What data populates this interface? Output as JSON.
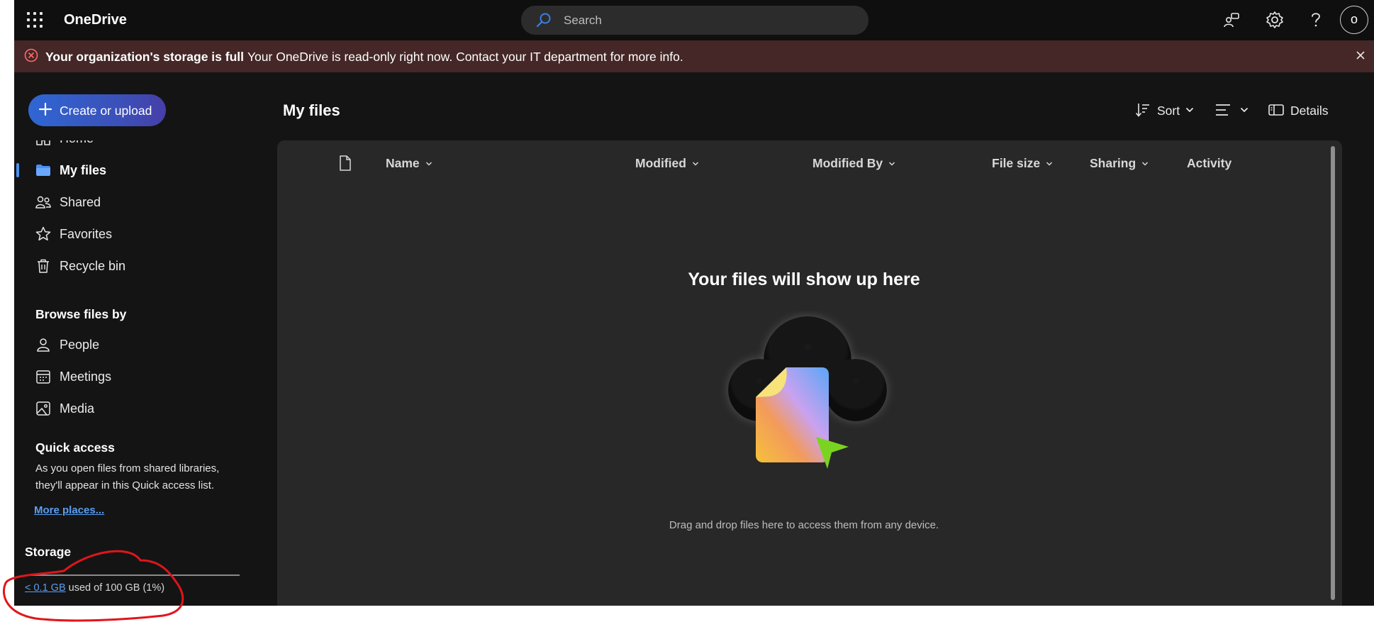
{
  "header": {
    "app_title": "OneDrive",
    "search_placeholder": "Search",
    "avatar_initial": "o",
    "icons": [
      "app-launcher-icon",
      "search-icon",
      "feedback-icon",
      "gear-icon",
      "help-icon"
    ]
  },
  "banner": {
    "title": "Your organization's storage is full",
    "message": "Your OneDrive is read-only right now. Contact your IT department for more info.",
    "icons": [
      "error-circle-icon",
      "close-icon"
    ]
  },
  "sidebar": {
    "create_label": "Create or upload",
    "nav": [
      {
        "label": "Home",
        "icon": "home-icon"
      },
      {
        "label": "My files",
        "icon": "folder-icon",
        "selected": true
      },
      {
        "label": "Shared",
        "icon": "people-icon"
      },
      {
        "label": "Favorites",
        "icon": "star-icon"
      },
      {
        "label": "Recycle bin",
        "icon": "trash-icon"
      }
    ],
    "browse_heading": "Browse files by",
    "browse": [
      {
        "label": "People",
        "icon": "person-icon"
      },
      {
        "label": "Meetings",
        "icon": "calendar-icon"
      },
      {
        "label": "Media",
        "icon": "image-icon"
      }
    ],
    "quick_access_heading": "Quick access",
    "quick_access_text": "As you open files from shared libraries, they'll appear in this Quick access list.",
    "more_places": "More places...",
    "storage": {
      "heading": "Storage",
      "used": "< 0.1 GB",
      "rest": "used of 100 GB (1%)",
      "fraction": 0.01
    }
  },
  "main": {
    "title": "My files",
    "commands": {
      "sort": "Sort",
      "details": "Details"
    },
    "columns": [
      "Name",
      "Modified",
      "Modified By",
      "File size",
      "Sharing",
      "Activity"
    ],
    "empty_title": "Your files will show up here",
    "empty_subtitle": "Drag and drop files here to access them from any device."
  },
  "colors": {
    "background": "#141414",
    "banner": "#442726",
    "panel": "#282828",
    "accent": "#4a90f0",
    "annotation": "#e0151b"
  }
}
